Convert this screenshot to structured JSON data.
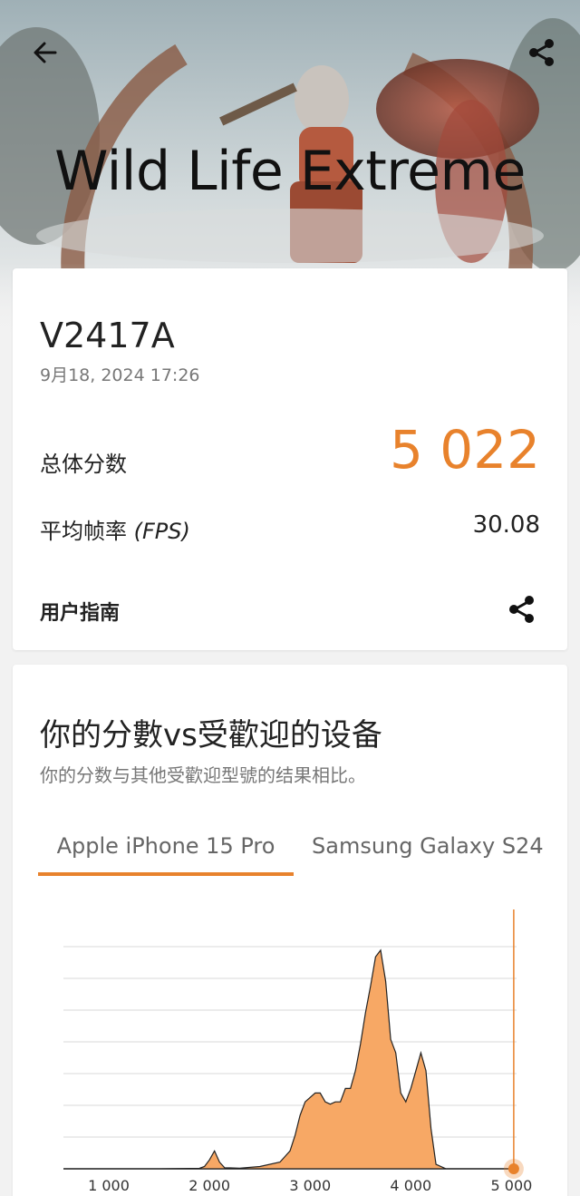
{
  "header": {
    "title": "Wild Life Extreme",
    "back_icon": "arrow-left-icon",
    "share_icon": "share-icon"
  },
  "result": {
    "device": "V2417A",
    "datetime": "9月18, 2024 17:26",
    "score_label": "总体分数",
    "score_value": "5 022",
    "fps_label": "平均帧率",
    "fps_unit": "(FPS)",
    "fps_value": "30.08",
    "guide_label": "用户指南",
    "accent_color": "#e8822c"
  },
  "comparison": {
    "title": "你的分數vs受歡迎的设备",
    "subtitle": "你的分数与其他受歡迎型號的结果相比。",
    "tabs": [
      {
        "label": "Apple iPhone 15 Pro",
        "selected": true
      },
      {
        "label": "Samsung Galaxy S24",
        "selected": false
      }
    ]
  },
  "chart_data": {
    "type": "area",
    "x_ticks": [
      "1 000",
      "2 000",
      "3 000",
      "4 000",
      "5 000"
    ],
    "xlim": [
      550,
      5050
    ],
    "marker_score": 5022,
    "points": [
      [
        550,
        0
      ],
      [
        1500,
        0
      ],
      [
        1900,
        0.2
      ],
      [
        1950,
        1
      ],
      [
        2000,
        4
      ],
      [
        2050,
        8
      ],
      [
        2100,
        3
      ],
      [
        2150,
        0.5
      ],
      [
        2300,
        0.3
      ],
      [
        2500,
        1
      ],
      [
        2700,
        3
      ],
      [
        2800,
        8
      ],
      [
        2850,
        15
      ],
      [
        2900,
        24
      ],
      [
        2950,
        30
      ],
      [
        3000,
        32
      ],
      [
        3050,
        34
      ],
      [
        3100,
        34
      ],
      [
        3150,
        30
      ],
      [
        3200,
        29
      ],
      [
        3250,
        30
      ],
      [
        3300,
        30
      ],
      [
        3350,
        36
      ],
      [
        3400,
        36
      ],
      [
        3450,
        44
      ],
      [
        3500,
        56
      ],
      [
        3550,
        70
      ],
      [
        3600,
        82
      ],
      [
        3650,
        95
      ],
      [
        3700,
        98
      ],
      [
        3750,
        84
      ],
      [
        3800,
        58
      ],
      [
        3850,
        52
      ],
      [
        3900,
        34
      ],
      [
        3950,
        30
      ],
      [
        4000,
        36
      ],
      [
        4050,
        44
      ],
      [
        4100,
        52
      ],
      [
        4150,
        44
      ],
      [
        4200,
        18
      ],
      [
        4250,
        2
      ],
      [
        4350,
        0
      ],
      [
        5050,
        0
      ]
    ]
  }
}
